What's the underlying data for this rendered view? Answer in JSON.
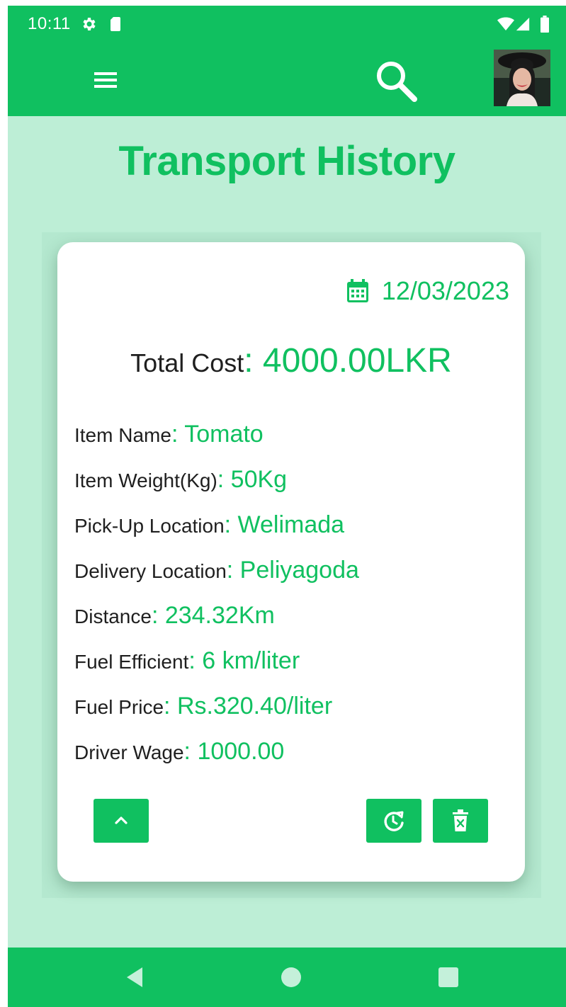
{
  "status_bar": {
    "time": "10:11",
    "icons": [
      "settings-icon",
      "sd-card-icon",
      "wifi-icon",
      "signal-icon",
      "battery-icon"
    ]
  },
  "app_bar": {
    "icons": [
      "menu-icon",
      "search-icon"
    ],
    "avatar": "profile-avatar"
  },
  "page": {
    "title": "Transport History"
  },
  "record": {
    "date_icon": "calendar-icon",
    "date": "12/03/2023",
    "total_label": "Total Cost",
    "total_value": ": 4000.00LKR",
    "details": [
      {
        "label": "Item Name",
        "value": ": Tomato"
      },
      {
        "label": "Item Weight(Kg)",
        "value": ": 50Kg"
      },
      {
        "label": "Pick-Up Location",
        "value": ": Welimada"
      },
      {
        "label": "Delivery Location",
        "value": ": Peliyagoda"
      },
      {
        "label": "Distance",
        "value": ": 234.32Km"
      },
      {
        "label": "Fuel Efficient",
        "value": ": 6 km/liter"
      },
      {
        "label": "Fuel Price",
        "value": ": Rs.320.40/liter"
      },
      {
        "label": "Driver Wage",
        "value": ": 1000.00"
      }
    ],
    "actions": [
      "collapse-icon",
      "history-refresh-icon",
      "delete-icon"
    ]
  },
  "nav_bar": {
    "icons": [
      "back-icon",
      "home-icon",
      "recents-icon"
    ]
  },
  "colors": {
    "primary": "#10c060",
    "background": "#bdeed6",
    "card": "#ffffff",
    "text": "#1f1f1f"
  }
}
